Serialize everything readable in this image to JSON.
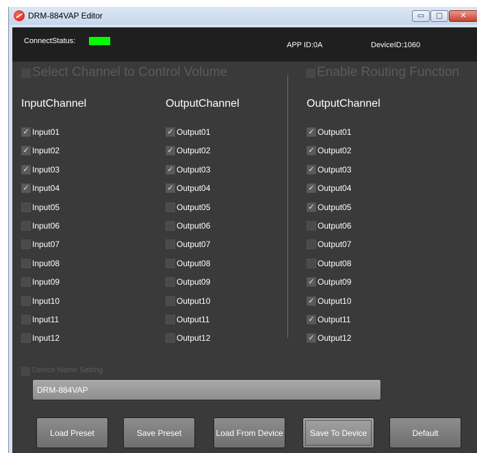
{
  "window": {
    "title": "DRM-884VAP Editor",
    "controls": {
      "minimize": "▭",
      "maximize": "▢",
      "close": "✕"
    }
  },
  "header": {
    "connect_status_label": "ConnectStatus:",
    "connect_status_color": "#00ff00",
    "app_id": "APP ID:0A",
    "device_id": "DeviceID:1060"
  },
  "sections": {
    "volume": {
      "label": "Select Channel to Control Volume",
      "checked": false
    },
    "routing": {
      "label": "Enable Routing Function",
      "checked": false
    }
  },
  "columns": [
    {
      "header": "InputChannel",
      "items": [
        {
          "label": "Input01",
          "checked": true
        },
        {
          "label": "Input02",
          "checked": true
        },
        {
          "label": "Input03",
          "checked": true
        },
        {
          "label": "Input04",
          "checked": true
        },
        {
          "label": "Input05",
          "checked": false
        },
        {
          "label": "Input06",
          "checked": false
        },
        {
          "label": "Input07",
          "checked": false
        },
        {
          "label": "Input08",
          "checked": false
        },
        {
          "label": "Input09",
          "checked": false
        },
        {
          "label": "Input10",
          "checked": false
        },
        {
          "label": "Input11",
          "checked": false
        },
        {
          "label": "Input12",
          "checked": false
        }
      ]
    },
    {
      "header": "OutputChannel",
      "items": [
        {
          "label": "Output01",
          "checked": true
        },
        {
          "label": "Output02",
          "checked": true
        },
        {
          "label": "Output03",
          "checked": true
        },
        {
          "label": "Output04",
          "checked": true
        },
        {
          "label": "Output05",
          "checked": false
        },
        {
          "label": "Output06",
          "checked": false
        },
        {
          "label": "Output07",
          "checked": false
        },
        {
          "label": "Output08",
          "checked": false
        },
        {
          "label": "Output09",
          "checked": false
        },
        {
          "label": "Output10",
          "checked": false
        },
        {
          "label": "Output11",
          "checked": false
        },
        {
          "label": "Output12",
          "checked": false
        }
      ]
    },
    {
      "header": "OutputChannel",
      "items": [
        {
          "label": "Output01",
          "checked": true
        },
        {
          "label": "Output02",
          "checked": true
        },
        {
          "label": "Output03",
          "checked": true
        },
        {
          "label": "Output04",
          "checked": true
        },
        {
          "label": "Output05",
          "checked": true
        },
        {
          "label": "Output06",
          "checked": false
        },
        {
          "label": "Output07",
          "checked": false
        },
        {
          "label": "Output08",
          "checked": false
        },
        {
          "label": "Output09",
          "checked": true
        },
        {
          "label": "Output10",
          "checked": true
        },
        {
          "label": "Output11",
          "checked": true
        },
        {
          "label": "Output12",
          "checked": true
        }
      ]
    }
  ],
  "device_name": {
    "label": "Device Name Setting",
    "value": "DRM-884VAP",
    "checked": false
  },
  "buttons": {
    "load_preset": "Load Preset",
    "save_preset": "Save Preset",
    "load_from_device": "Load From Device",
    "save_to_device": "Save To Device",
    "default": "Default"
  },
  "check_glyph": "✓"
}
